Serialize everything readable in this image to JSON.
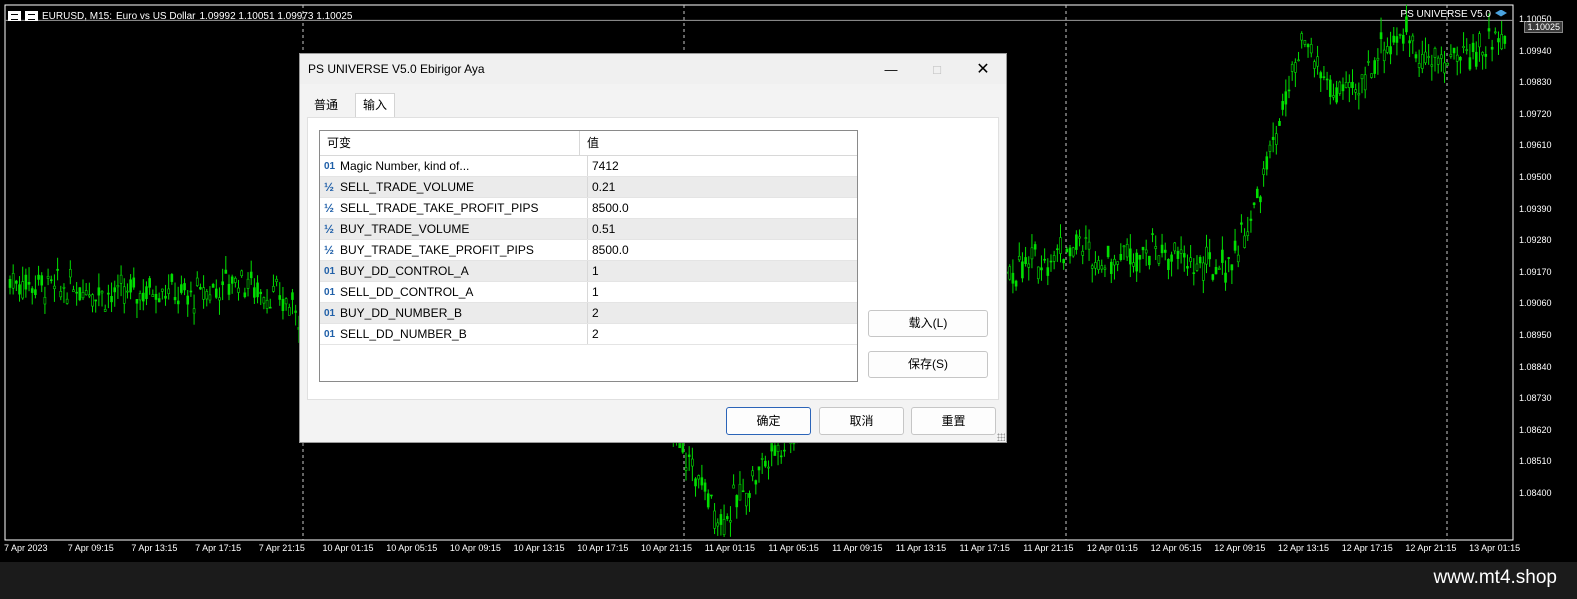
{
  "chart": {
    "header": {
      "symbol": "EURUSD, M15:",
      "description": "Euro vs US Dollar",
      "ohlc": "1.09992 1.10051 1.09973 1.10025"
    },
    "ea_name": "PS UNIVERSE V5.0",
    "current_price": "1.10025",
    "price_labels": [
      "1.10050",
      "1.09940",
      "1.09830",
      "1.09720",
      "1.09610",
      "1.09500",
      "1.09390",
      "1.09280",
      "1.09170",
      "1.09060",
      "1.08950",
      "1.08840",
      "1.08730",
      "1.08620",
      "1.08510",
      "1.08400"
    ],
    "time_labels": [
      "7 Apr 2023",
      "7 Apr 09:15",
      "7 Apr 13:15",
      "7 Apr 17:15",
      "7 Apr 21:15",
      "10 Apr 01:15",
      "10 Apr 05:15",
      "10 Apr 09:15",
      "10 Apr 13:15",
      "10 Apr 17:15",
      "10 Apr 21:15",
      "11 Apr 01:15",
      "11 Apr 05:15",
      "11 Apr 09:15",
      "11 Apr 13:15",
      "11 Apr 17:15",
      "11 Apr 21:15",
      "12 Apr 01:15",
      "12 Apr 05:15",
      "12 Apr 09:15",
      "12 Apr 13:15",
      "12 Apr 17:15",
      "12 Apr 21:15",
      "13 Apr 01:15"
    ],
    "price_series": [
      1.0918,
      1.0917,
      1.0915,
      1.0916,
      1.0913,
      1.0914,
      1.0916,
      1.0912,
      1.0915,
      1.0919,
      1.0914,
      1.091,
      1.0905,
      1.0885,
      1.0895,
      1.0908,
      1.0912,
      1.0909,
      1.0907,
      1.0906,
      1.0904,
      1.0905,
      1.0902,
      1.09,
      1.0895,
      1.0885,
      1.087,
      1.0855,
      1.084,
      1.085,
      1.0862,
      1.087,
      1.088,
      1.0892,
      1.0905,
      1.0915,
      1.0918,
      1.0912,
      1.0915,
      1.092,
      1.0922,
      1.0926,
      1.093,
      1.0924,
      1.0927,
      1.0928,
      1.0925,
      1.0922,
      1.0923,
      1.094,
      1.097,
      1.0995,
      1.098,
      1.0978,
      1.0994,
      1.0998,
      1.0988,
      1.0991,
      1.0993,
      1.1002
    ],
    "colors": {
      "candles": "#00e000",
      "background": "#000000",
      "grid": "#c8c8c8"
    }
  },
  "dialog": {
    "title": "PS UNIVERSE V5.0 Ebirigor Aya",
    "tabs": [
      "普通",
      "输入"
    ],
    "table": {
      "headers": [
        "可变",
        "值"
      ],
      "rows": [
        {
          "icon": "01",
          "name": "Magic Number, kind of...",
          "value": "7412"
        },
        {
          "icon": "½",
          "name": "SELL_TRADE_VOLUME",
          "value": "0.21"
        },
        {
          "icon": "½",
          "name": "SELL_TRADE_TAKE_PROFIT_PIPS",
          "value": "8500.0"
        },
        {
          "icon": "½",
          "name": "BUY_TRADE_VOLUME",
          "value": "0.51"
        },
        {
          "icon": "½",
          "name": "BUY_TRADE_TAKE_PROFIT_PIPS",
          "value": "8500.0"
        },
        {
          "icon": "01",
          "name": "BUY_DD_CONTROL_A",
          "value": "1"
        },
        {
          "icon": "01",
          "name": "SELL_DD_CONTROL_A",
          "value": "1"
        },
        {
          "icon": "01",
          "name": "BUY_DD_NUMBER_B",
          "value": "2"
        },
        {
          "icon": "01",
          "name": "SELL_DD_NUMBER_B",
          "value": "2"
        }
      ]
    },
    "buttons": {
      "load": "载入(L)",
      "save": "保存(S)",
      "ok": "确定",
      "cancel": "取消",
      "reset": "重置"
    }
  },
  "watermark": "www.mt4.shop"
}
